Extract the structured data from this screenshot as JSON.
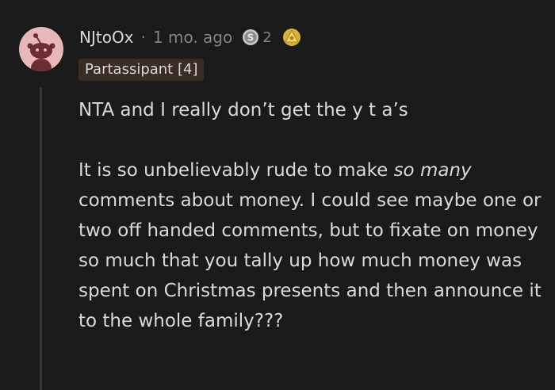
{
  "comment": {
    "author": "NJtoOx",
    "separator": "·",
    "time_ago": "1 mo. ago",
    "award_count": "2",
    "award_icons": [
      "silver-award-icon",
      "helpful-award-icon"
    ],
    "flair": "Partassipant [4]",
    "avatar_icon": "reddit-snoo-avatar-icon",
    "body": {
      "p1": "NTA and I really don’t get the y t a’s",
      "p2_before": "It is so unbelievably rude to make ",
      "p2_emphasis": "so many",
      "p2_after": " comments about money. I could see maybe one or two off handed comments, but to fixate on money so much that you tally up how much money was spent on Christmas presents and then announce it to the whole family???"
    }
  },
  "colors": {
    "background": "#1a1a1b",
    "text": "#d7dadc",
    "meta_text": "#818384",
    "flair_bg": "#3a2b24",
    "avatar_bg": "#e8b7b9",
    "thread_line": "#343536"
  }
}
